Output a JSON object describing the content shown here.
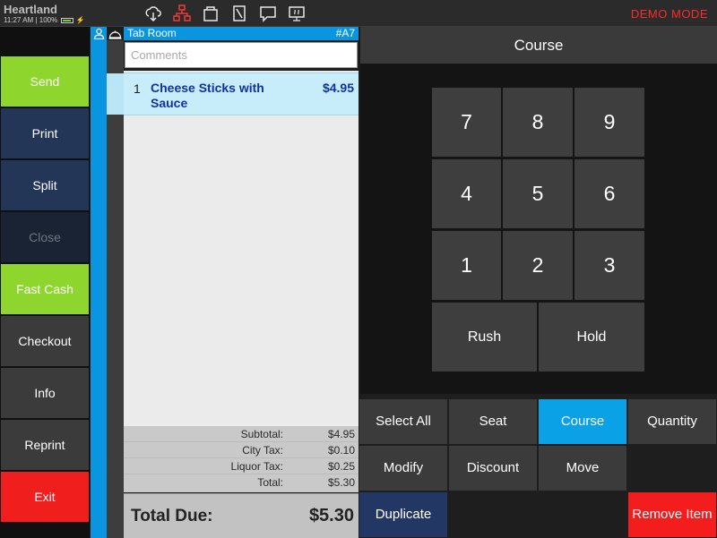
{
  "topbar": {
    "brand": "Heartland",
    "time": "11:27 AM",
    "battery_percent": "100%",
    "demo_label": "DEMO MODE",
    "icons": [
      "cloud-sync-icon",
      "network-icon",
      "bag-icon",
      "card-reader-icon",
      "message-icon",
      "kitchen-display-icon"
    ]
  },
  "actions": [
    "Send",
    "Print",
    "Split",
    "Close",
    "Fast Cash",
    "Checkout",
    "Info",
    "Reprint",
    "Exit"
  ],
  "ticket": {
    "room": "Tab Room",
    "number": "#A7",
    "comments_placeholder": "Comments",
    "items": [
      {
        "qty": "1",
        "name": "Cheese Sticks with Sauce",
        "price": "$4.95"
      }
    ],
    "totals": {
      "subtotal_label": "Subtotal:",
      "subtotal": "$4.95",
      "city_tax_label": "City Tax:",
      "city_tax": "$0.10",
      "liquor_tax_label": "Liquor Tax:",
      "liquor_tax": "$0.25",
      "total_label": "Total:",
      "total": "$5.30"
    },
    "total_due_label": "Total Due:",
    "total_due": "$5.30"
  },
  "keypad": {
    "title": "Course",
    "keys": [
      "7",
      "8",
      "9",
      "4",
      "5",
      "6",
      "1",
      "2",
      "3"
    ],
    "rush": "Rush",
    "hold": "Hold"
  },
  "modifiers": {
    "select_all": "Select All",
    "seat": "Seat",
    "course": "Course",
    "quantity": "Quantity",
    "modify": "Modify",
    "discount": "Discount",
    "move": "Move",
    "duplicate": "Duplicate",
    "remove_item": "Remove Item"
  },
  "colors": {
    "accent_blue": "#0a95e0",
    "send_green": "#8ed62d",
    "exit_red": "#f11e1e",
    "navy": "#243657",
    "demo_red": "#ff2b2b"
  }
}
